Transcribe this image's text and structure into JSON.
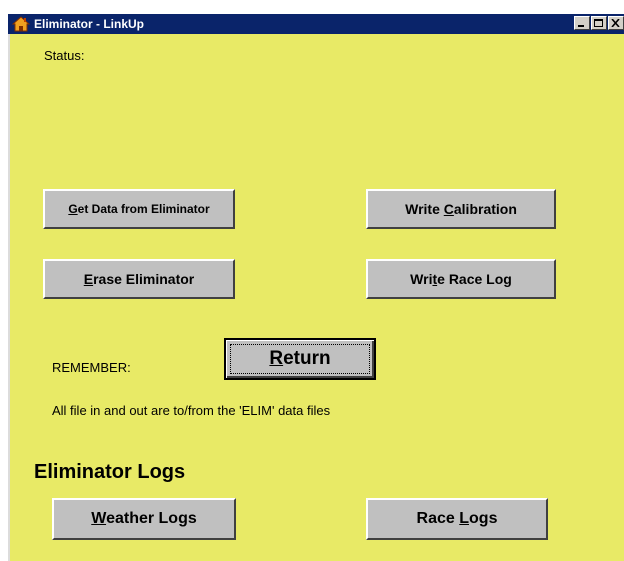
{
  "window": {
    "title": "Eliminator - LinkUp",
    "icon": "house-icon",
    "controls": [
      "minimize-icon",
      "maximize-icon",
      "close-icon"
    ],
    "background_color": "#e8ea66",
    "titlebar_color": "#0a246a"
  },
  "status": {
    "label": "Status:"
  },
  "buttons": {
    "get_data": {
      "pre": "",
      "key": "G",
      "post": "et Data from Eliminator"
    },
    "write_calibration": {
      "pre": "Write ",
      "key": "C",
      "post": "alibration"
    },
    "erase": {
      "pre": "",
      "key": "E",
      "post": "rase Eliminator"
    },
    "write_race_log": {
      "pre": "Wri",
      "key": "t",
      "post": "e Race Log"
    },
    "return": {
      "pre": "",
      "key": "R",
      "post": "eturn"
    },
    "weather_logs": {
      "pre": "",
      "key": "W",
      "post": "eather Logs"
    },
    "race_logs": {
      "pre": "Race ",
      "key": "L",
      "post": "ogs"
    }
  },
  "remember_label": "REMEMBER:",
  "note": "All file in and out are to/from the 'ELIM' data files",
  "logs_heading": "Eliminator Logs"
}
